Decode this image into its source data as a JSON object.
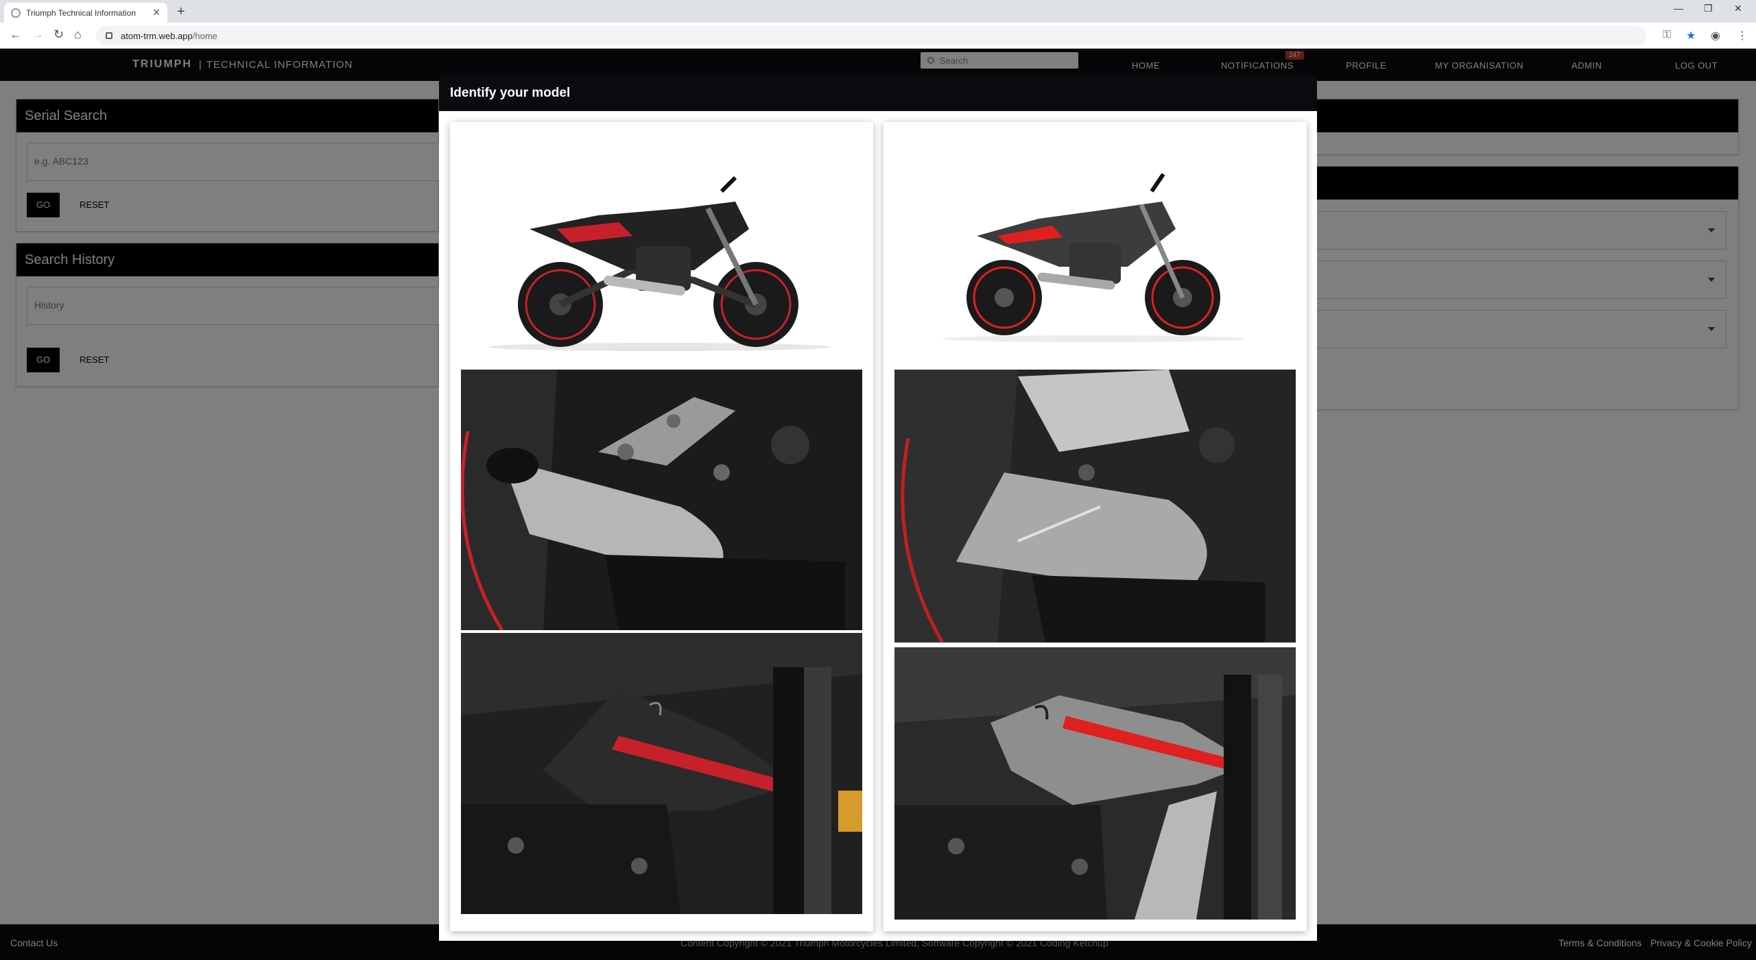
{
  "browser": {
    "tab_title": "Triumph Technical Information",
    "url_domain": "atom-trm.web.app",
    "url_path": "/home"
  },
  "header": {
    "brand_logo": "TRIUMPH",
    "brand_section": "TECHNICAL INFORMATION",
    "search_placeholder": "Search",
    "nav": {
      "home": "HOME",
      "notifications": "NOTIFICATIONS",
      "notifications_count": "247",
      "profile": "PROFILE",
      "my_organisation": "MY ORGANISATION",
      "admin": "ADMIN",
      "logout": "LOG OUT"
    }
  },
  "serial_search": {
    "title": "Serial Search",
    "placeholder": "e.g. ABC123",
    "go_label": "GO",
    "reset_label": "RESET"
  },
  "search_history": {
    "title": "Search History",
    "placeholder": "History",
    "go_label": "GO",
    "reset_label": "RESET"
  },
  "footer": {
    "contact": "Contact Us",
    "copyright": "Content Copyright © 2021 Triumph Motorcycles Limited, Software Copyright © 2021 Coding Ketchup",
    "terms": "Terms & Conditions",
    "privacy": "Privacy & Cookie Policy"
  },
  "modal": {
    "title": "Identify your model",
    "options": [
      {
        "image": "motorcycle-model-a",
        "accent": "#c8202a"
      },
      {
        "image": "motorcycle-model-b",
        "accent": "#e02020"
      }
    ]
  },
  "colors": {
    "header_bg": "#0b0b0f",
    "accent_red": "#c0392b",
    "panel_black": "#000000"
  }
}
